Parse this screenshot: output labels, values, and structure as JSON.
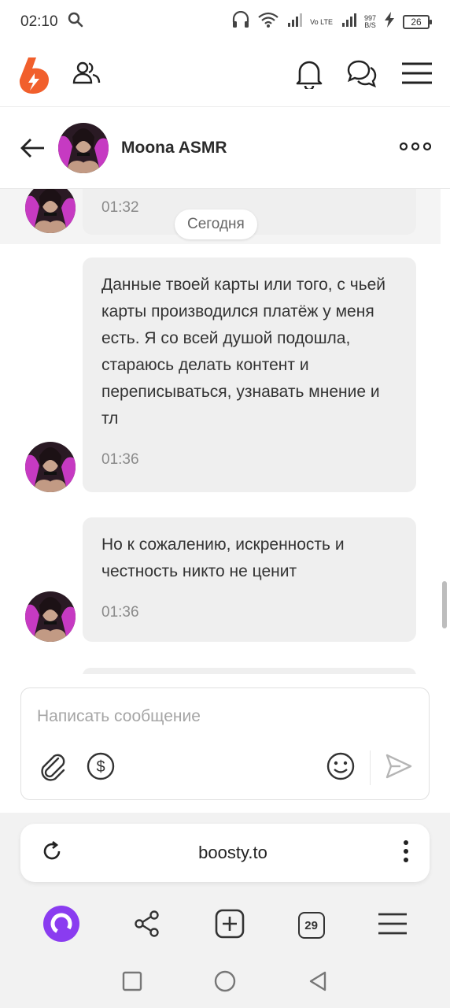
{
  "status_bar": {
    "time": "02:10",
    "network_type": "Vo LTE",
    "speed_value": "997",
    "speed_unit": "B/S",
    "battery": "26"
  },
  "app": {
    "brand_color": "#f15f2c"
  },
  "chat": {
    "name": "Moona ASMR",
    "previous_time": "01:32",
    "date_divider": "Сегодня",
    "messages": [
      {
        "text": "Данные твоей карты или того, с чьей карты производился платёж у меня есть. Я со  всей душой подошла, стараюсь делать контент и переписываться, узнавать  мнение и тл",
        "time": "01:36"
      },
      {
        "text": "Но к сожалению, искренность и честность никто не ценит",
        "time": "01:36"
      }
    ]
  },
  "composer": {
    "placeholder": "Написать сообщение"
  },
  "browser": {
    "url": "boosty.to",
    "tabs_count": "29"
  }
}
